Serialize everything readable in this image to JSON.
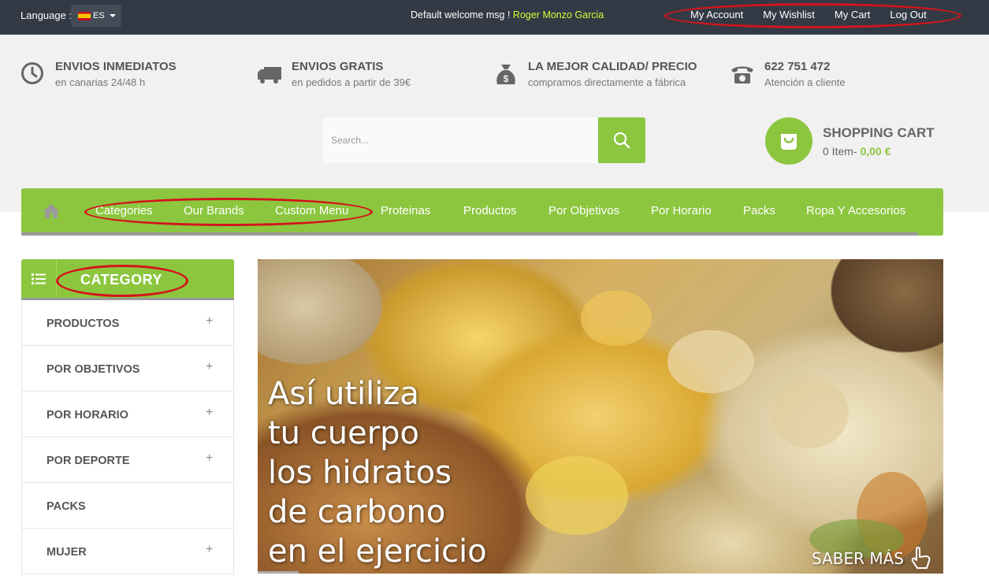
{
  "topbar": {
    "language_label": "Language :",
    "language_value": "ES",
    "welcome_text": "Default welcome msg !",
    "user_name": "Roger Monzo Garcia",
    "links": [
      "My Account",
      "My Wishlist",
      "My Cart",
      "Log Out"
    ]
  },
  "features": [
    {
      "icon": "clock-icon",
      "title": "ENVIOS INMEDIATOS",
      "subtitle": "en canarias 24/48 h"
    },
    {
      "icon": "truck-icon",
      "title": "ENVIOS GRATIS",
      "subtitle": "en pedidos a partir de 39€"
    },
    {
      "icon": "money-bag-icon",
      "title": "LA MEJOR CALIDAD/ PRECIO",
      "subtitle": "compramos directamente a fábrica"
    },
    {
      "icon": "phone-icon",
      "title": "622 751 472",
      "subtitle": "Atención a cliente"
    }
  ],
  "search": {
    "placeholder": "Search..."
  },
  "cart": {
    "title": "SHOPPING CART",
    "items_text": "0 Item-",
    "total": "0,00 €"
  },
  "nav": {
    "items": [
      "Categories",
      "Our Brands",
      "Custom Menu",
      "Proteinas",
      "Productos",
      "Por Objetivos",
      "Por Horario",
      "Packs",
      "Ropa Y Accesorios"
    ]
  },
  "category": {
    "title": "CATEGORY",
    "items": [
      {
        "label": "PRODUCTOS",
        "expandable": "+"
      },
      {
        "label": "POR OBJETIVOS",
        "expandable": "+"
      },
      {
        "label": "POR HORARIO",
        "expandable": "+"
      },
      {
        "label": "POR DEPORTE",
        "expandable": "+"
      },
      {
        "label": "PACKS",
        "expandable": ""
      },
      {
        "label": "MUJER",
        "expandable": "+"
      }
    ]
  },
  "banner": {
    "lines": [
      "Así utiliza",
      "tu cuerpo",
      "los hidratos",
      "de carbono",
      "en el ejercicio"
    ],
    "cta": "SABER MÁS"
  },
  "colors": {
    "accent": "#8cc63f",
    "topbar": "#333a45",
    "annotation": "#d3141b",
    "username": "#d4ff3a"
  }
}
